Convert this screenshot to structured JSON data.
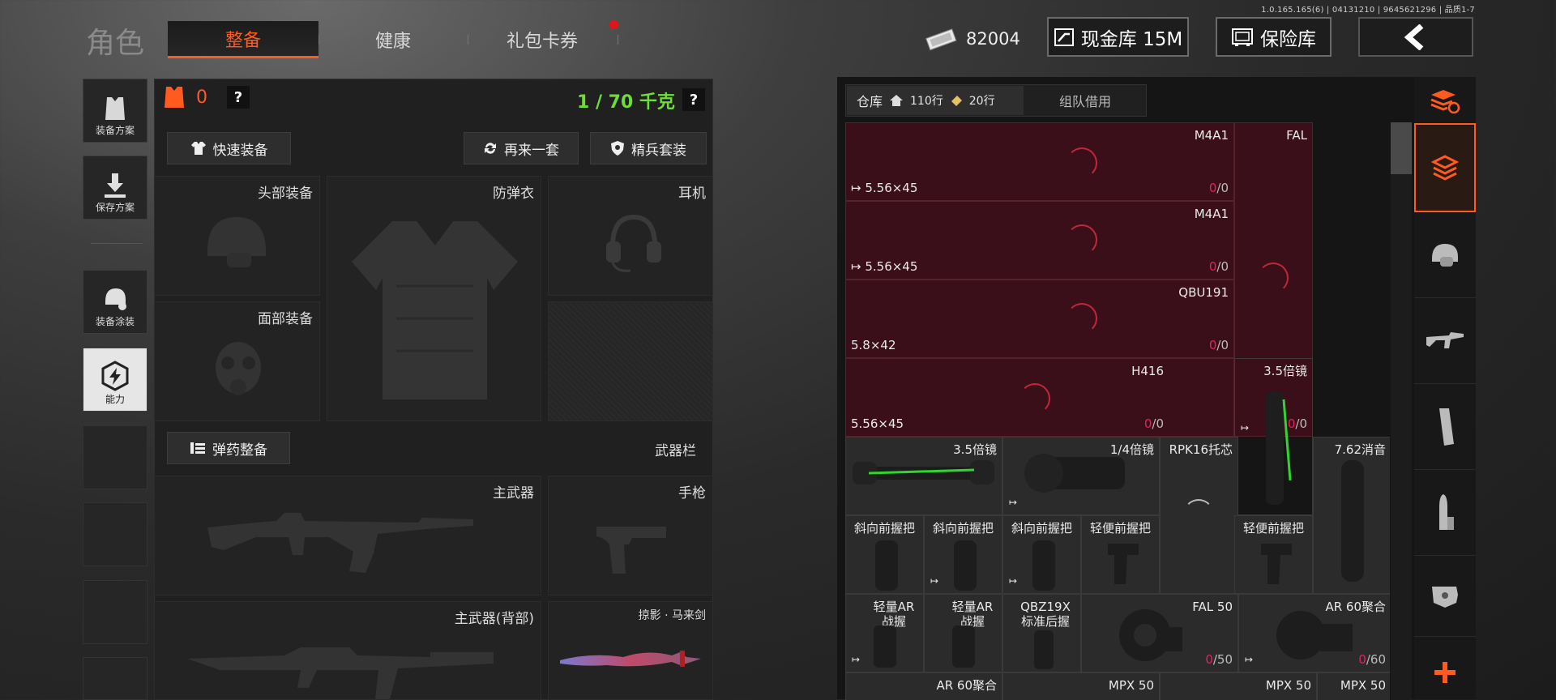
{
  "header": {
    "version": "1.0.165.165(6) | 04131210 | 9645621296 | 品质1-7",
    "title": "角色",
    "tabs": [
      "整备",
      "健康",
      "礼包卡券"
    ],
    "money_amount": "82004",
    "cash_vault_label": "现金库 15M",
    "safe_vault_label": "保险库"
  },
  "left_sidebar": {
    "items": [
      {
        "label": "装备方案",
        "icon": "vest-icon"
      },
      {
        "label": "保存方案",
        "icon": "download-icon"
      },
      {
        "label": "装备涂装",
        "icon": "helmet-paint-icon"
      },
      {
        "label": "能力",
        "icon": "lightning-hex-icon"
      }
    ]
  },
  "loadout": {
    "armor_count": "0",
    "weight": "1 / 70 千克",
    "help_label": "?",
    "quick_equip_label": "快速装备",
    "again_set_label": "再来一套",
    "elite_set_label": "精兵套装",
    "slots": {
      "head": "头部装备",
      "vest": "防弹衣",
      "headset": "耳机",
      "face": "面部装备",
      "primary": "主武器",
      "pistol": "手枪",
      "primary_back": "主武器(背部)",
      "melee": "掠影 · 马来剑"
    },
    "ammo_label": "弹药整备",
    "weapon_bar_label": "武器栏"
  },
  "warehouse": {
    "tab_warehouse": "仓库",
    "rows_house": "110行",
    "rows_extra": "20行",
    "tab_team": "组队借用",
    "items": [
      {
        "name": "M4A1",
        "caliber": "5.56×45",
        "count_a": "0",
        "count_b": "/0"
      },
      {
        "name": "FAL",
        "caliber": "",
        "count_a": "",
        "count_b": ""
      },
      {
        "name": "M4A1",
        "caliber": "5.56×45",
        "count_a": "0",
        "count_b": "/0"
      },
      {
        "name": "QBU191",
        "caliber": "5.8×42",
        "count_a": "0",
        "count_b": "/0"
      },
      {
        "name": "H416",
        "caliber": "5.56×45",
        "count_a": "0",
        "count_b": "/0"
      },
      {
        "name": "3.5倍镜",
        "caliber": "",
        "count_a": "0",
        "count_b": "/0"
      },
      {
        "name": "3.5倍镜"
      },
      {
        "name": "1/4倍镜"
      },
      {
        "name": "RPK16托芯"
      },
      {
        "name": "7.62消音"
      },
      {
        "name": "斜向前握把"
      },
      {
        "name": "斜向前握把"
      },
      {
        "name": "斜向前握把"
      },
      {
        "name": "轻便前握把"
      },
      {
        "name": "轻便前握把"
      },
      {
        "name": "轻量AR战握"
      },
      {
        "name": "轻量AR战握"
      },
      {
        "name": "QBZ19X标准后握"
      },
      {
        "name": "FAL 50",
        "count_a": "0",
        "count_b": "/50"
      },
      {
        "name": "AR 60聚合",
        "count_a": "0",
        "count_b": "/60"
      },
      {
        "name": "AR 60聚合"
      },
      {
        "name": "MPX 50"
      },
      {
        "name": "MPX 50"
      },
      {
        "name": "MPX 50"
      }
    ]
  },
  "right_sidebar": {
    "icons": [
      "stack-refresh-icon",
      "layers-icon",
      "helmet-icon",
      "rifle-icon",
      "magazine-icon",
      "bullet-icon",
      "scope-icon",
      "plus-icon"
    ]
  },
  "colors": {
    "accent": "#ff5a1f",
    "weight_green": "#6fdc3a",
    "red_cell": "#3a0f1a",
    "count_red": "#e0245e"
  }
}
